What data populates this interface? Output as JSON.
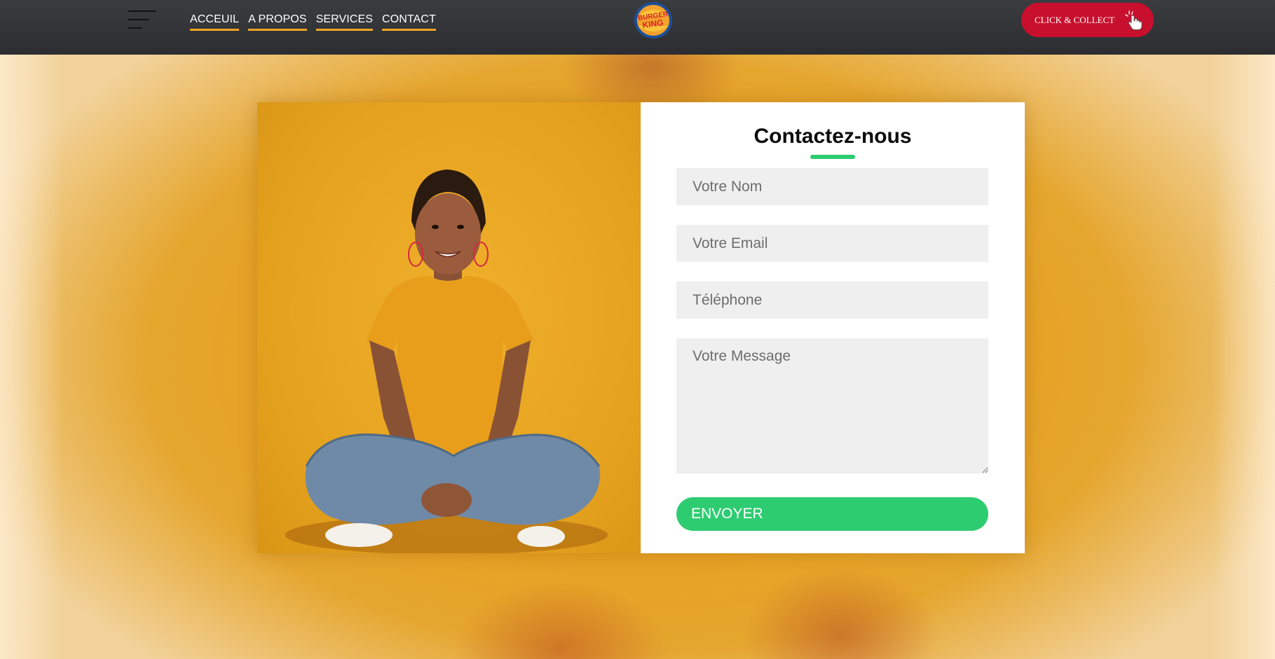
{
  "header": {
    "menu_icon": "hamburger-menu-icon",
    "nav": [
      {
        "label": "ACCEUIL"
      },
      {
        "label": "A PROPOS"
      },
      {
        "label": "SERVICES"
      },
      {
        "label": "CONTACT"
      }
    ],
    "logo_text": "BURGER KING",
    "cta_label": "CLICK & COLLECT",
    "cta_icon": "pointer-hand-icon"
  },
  "contact": {
    "title": "Contactez-nous",
    "name_placeholder": "Votre Nom",
    "email_placeholder": "Votre Email",
    "phone_placeholder": "Téléphone",
    "message_placeholder": "Votre Message",
    "submit_label": "ENVOYER"
  },
  "colors": {
    "accent_green": "#2ecc71",
    "brand_red": "#c8102e",
    "nav_underline": "#f0a524",
    "background_yellow": "#e9a321"
  }
}
